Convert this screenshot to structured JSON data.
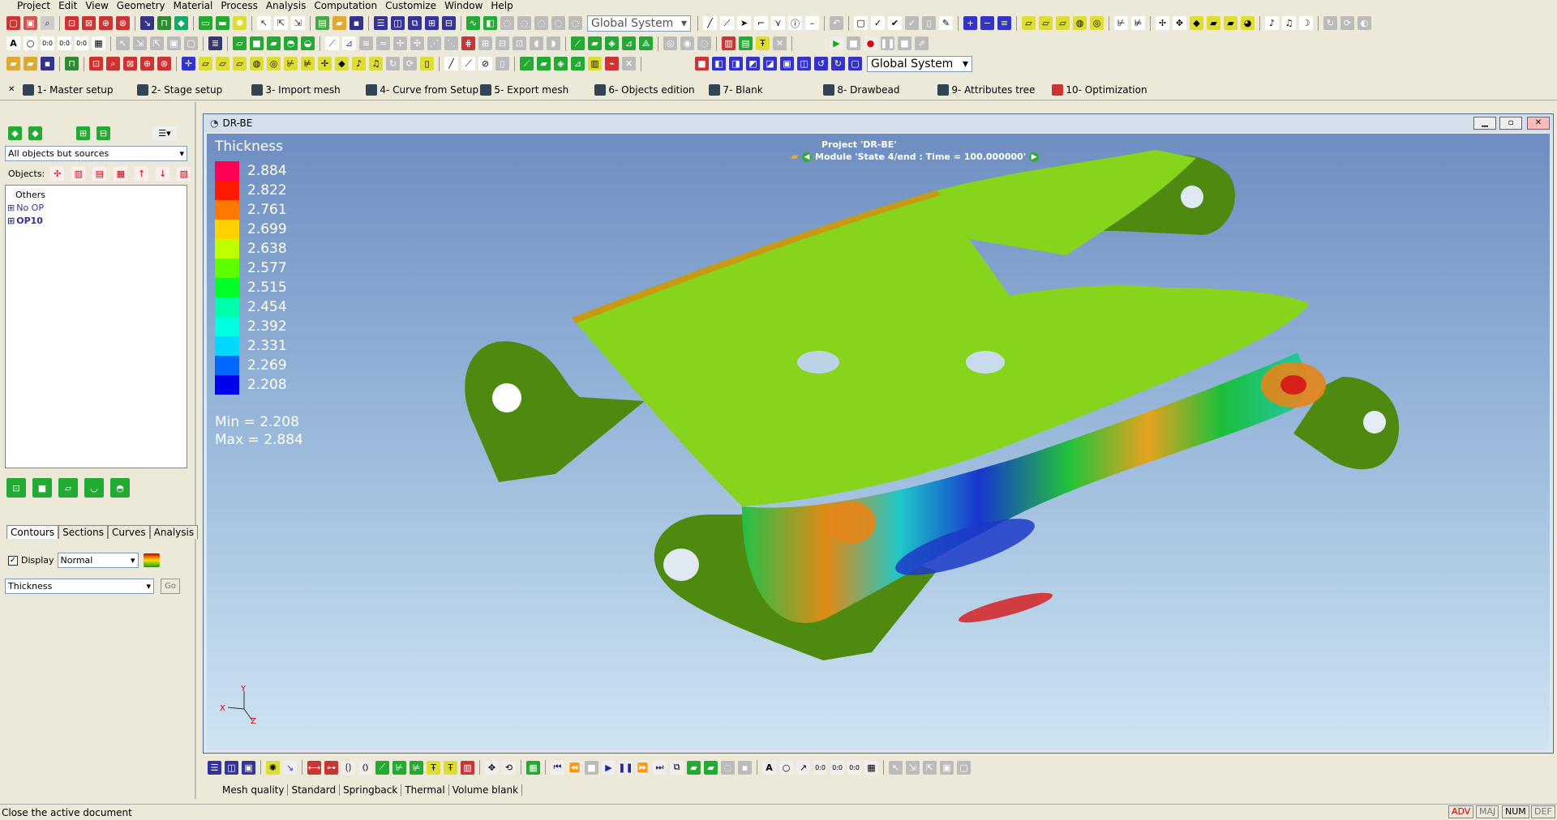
{
  "menu": [
    "Project",
    "Edit",
    "View",
    "Geometry",
    "Material",
    "Process",
    "Analysis",
    "Computation",
    "Customize",
    "Window",
    "Help"
  ],
  "toolbar": {
    "coord_system_1": "Global System",
    "coord_system_2": "Global System"
  },
  "stages": [
    "1- Master setup",
    "2- Stage setup",
    "3- Import mesh",
    "4- Curve from Setup",
    "5- Export mesh",
    "6- Objects edition",
    "7- Blank",
    "8- Drawbead",
    "9- Attributes tree",
    "10- Optimization"
  ],
  "left": {
    "filter": "All objects but sources",
    "objects_label": "Objects:",
    "tree": [
      "Others",
      "No OP",
      "OP10"
    ],
    "tabs": [
      "Contours",
      "Sections",
      "Curves",
      "Analysis"
    ],
    "display_label": "Display",
    "display_mode": "Normal",
    "field": "Thickness",
    "go": "Go"
  },
  "viewport": {
    "title": "DR-BE",
    "project": "Project 'DR-BE'",
    "module": "Module 'State 4/end : Time = 100.000000'",
    "legend_title": "Thickness",
    "legend": [
      {
        "v": "2.884",
        "c": "#ff0055"
      },
      {
        "v": "2.822",
        "c": "#ff1a00"
      },
      {
        "v": "2.761",
        "c": "#ff7800"
      },
      {
        "v": "2.699",
        "c": "#ffd200"
      },
      {
        "v": "2.638",
        "c": "#c0ff00"
      },
      {
        "v": "2.577",
        "c": "#5cff00"
      },
      {
        "v": "2.515",
        "c": "#00ff2a"
      },
      {
        "v": "2.454",
        "c": "#00ffaa"
      },
      {
        "v": "2.392",
        "c": "#00ffe0"
      },
      {
        "v": "2.331",
        "c": "#00d8ff"
      },
      {
        "v": "2.269",
        "c": "#0068ff"
      },
      {
        "v": "2.208",
        "c": "#0000ee"
      }
    ],
    "min_label": "Min =  2.208",
    "max_label": "Max =  2.884",
    "axes": [
      "Y",
      "X",
      "Z"
    ]
  },
  "bottom_tabs": [
    "Mesh quality",
    "Standard",
    "Springback",
    "Thermal",
    "Volume blank"
  ],
  "status": {
    "text": "Close the active document",
    "ind": [
      "ADV",
      "MAJ",
      "NUM",
      "DEF"
    ]
  }
}
